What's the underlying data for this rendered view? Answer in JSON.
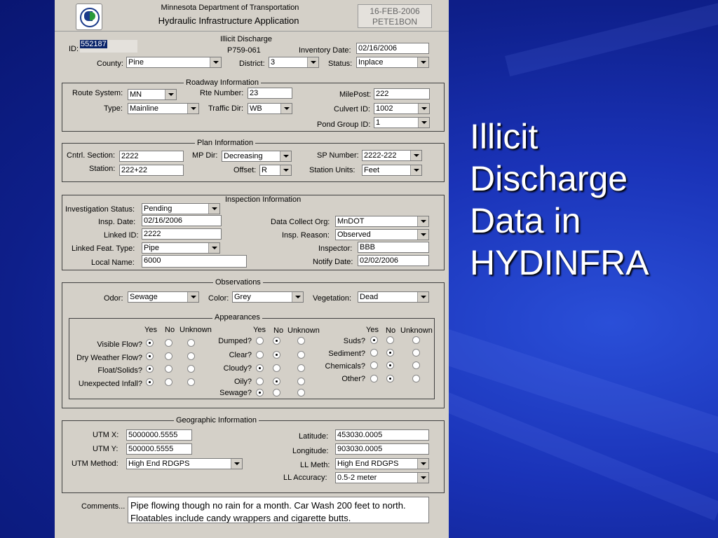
{
  "slide_title": "Illicit\nDischarge\nData in\nHYDINFRA",
  "app": {
    "agency": "Minnesota Department of Transportation",
    "name": "Hydraulic Infrastructure Application",
    "date": "16-FEB-2006",
    "user": "PETE1BON"
  },
  "record": {
    "title": "Illicit Discharge",
    "code": "P759-061",
    "id_label": "ID:",
    "id_value": "552187",
    "inventory_date_label": "Inventory Date:",
    "inventory_date": "02/16/2006",
    "county_label": "County:",
    "county": "Pine",
    "district_label": "District:",
    "district": "3",
    "status_label": "Status:",
    "status": "Inplace"
  },
  "roadway": {
    "title": "Roadway Information",
    "route_system_label": "Route System:",
    "route_system": "MN",
    "rte_number_label": "Rte Number:",
    "rte_number": "23",
    "milepost_label": "MilePost:",
    "milepost": "222",
    "type_label": "Type:",
    "type": "Mainline",
    "traffic_dir_label": "Traffic Dir:",
    "traffic_dir": "WB",
    "culvert_id_label": "Culvert ID:",
    "culvert_id": "1002",
    "pond_group_label": "Pond Group ID:",
    "pond_group": "1"
  },
  "plan": {
    "title": "Plan Information",
    "cntrl_section_label": "Cntrl. Section:",
    "cntrl_section": "2222",
    "mp_dir_label": "MP Dir:",
    "mp_dir": "Decreasing",
    "sp_number_label": "SP Number:",
    "sp_number": "2222-222",
    "station_label": "Station:",
    "station": "222+22",
    "offset_label": "Offset:",
    "offset": "R",
    "station_units_label": "Station Units:",
    "station_units": "Feet"
  },
  "inspection": {
    "title": "Inspection Information",
    "inv_status_label": "Investigation Status:",
    "inv_status": "Pending",
    "insp_date_label": "Insp. Date:",
    "insp_date": "02/16/2006",
    "linked_id_label": "Linked ID:",
    "linked_id": "2222",
    "linked_feat_label": "Linked Feat. Type:",
    "linked_feat": "Pipe",
    "local_name_label": "Local Name:",
    "local_name": "6000",
    "data_org_label": "Data Collect Org:",
    "data_org": "MnDOT",
    "insp_reason_label": "Insp. Reason:",
    "insp_reason": "Observed",
    "inspector_label": "Inspector:",
    "inspector": "BBB",
    "notify_date_label": "Notify Date:",
    "notify_date": "02/02/2006"
  },
  "observations": {
    "title": "Observations",
    "odor_label": "Odor:",
    "odor": "Sewage",
    "color_label": "Color:",
    "color": "Grey",
    "vegetation_label": "Vegetation:",
    "vegetation": "Dead"
  },
  "appearances": {
    "title": "Appearances",
    "col_yes": "Yes",
    "col_no": "No",
    "col_unknown": "Unknown",
    "col1": [
      {
        "label": "Visible Flow?",
        "sel": 0
      },
      {
        "label": "Dry Weather Flow?",
        "sel": 0
      },
      {
        "label": "Float/Solids?",
        "sel": 0
      },
      {
        "label": "Unexpected Infall?",
        "sel": 0
      }
    ],
    "col2": [
      {
        "label": "Dumped?",
        "sel": 1
      },
      {
        "label": "Clear?",
        "sel": 1
      },
      {
        "label": "Cloudy?",
        "sel": 0
      },
      {
        "label": "Oily?",
        "sel": 1
      },
      {
        "label": "Sewage?",
        "sel": 0
      }
    ],
    "col3": [
      {
        "label": "Suds?",
        "sel": 0
      },
      {
        "label": "Sediment?",
        "sel": 1
      },
      {
        "label": "Chemicals?",
        "sel": 1
      },
      {
        "label": "Other?",
        "sel": 1
      }
    ]
  },
  "geo": {
    "title": "Geographic Information",
    "utm_x_label": "UTM X:",
    "utm_x": "5000000.5555",
    "utm_y_label": "UTM Y:",
    "utm_y": "500000.5555",
    "utm_method_label": "UTM Method:",
    "utm_method": "High End RDGPS",
    "latitude_label": "Latitude:",
    "latitude": "453030.0005",
    "longitude_label": "Longitude:",
    "longitude": "903030.0005",
    "ll_meth_label": "LL Meth:",
    "ll_meth": "High End RDGPS",
    "ll_accuracy_label": "LL Accuracy:",
    "ll_accuracy": "0.5-2 meter"
  },
  "comments": {
    "label": "Comments...",
    "text": "Pipe flowing though no rain for a month.  Car Wash 200 feet to north.  Floatables include candy wrappers and cigarette butts."
  },
  "colors": {
    "background": "#1a33b8",
    "form": "#d4d0c8",
    "selection": "#0a246a"
  }
}
